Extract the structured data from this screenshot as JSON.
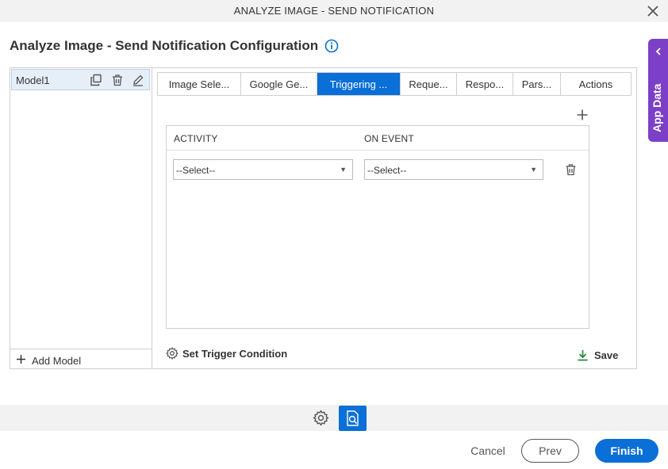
{
  "window": {
    "title": "ANALYZE IMAGE - SEND NOTIFICATION",
    "close_icon": "close-icon"
  },
  "page": {
    "heading": "Analyze Image - Send Notification Configuration",
    "info_icon": "info-icon"
  },
  "side_tab": {
    "label": "App Data",
    "icon": "chevron-left-icon",
    "color": "#7c3fc7"
  },
  "models": {
    "items": [
      {
        "name": "Model1"
      }
    ],
    "add_label": "Add Model",
    "item_icons": [
      "copy-icon",
      "trash-icon",
      "edit-icon"
    ]
  },
  "tabs": [
    {
      "label": "Image Sele...",
      "active": false
    },
    {
      "label": "Google Ge...",
      "active": false
    },
    {
      "label": "Triggering ...",
      "active": true
    },
    {
      "label": "Reque...",
      "active": false
    },
    {
      "label": "Respo...",
      "active": false
    },
    {
      "label": "Pars...",
      "active": false
    },
    {
      "label": "Actions",
      "active": false
    }
  ],
  "grid": {
    "columns": [
      "ACTIVITY",
      "ON EVENT"
    ],
    "rows": [
      {
        "activity": "--Select--",
        "on_event": "--Select--"
      }
    ]
  },
  "actions": {
    "set_trigger": "Set Trigger Condition",
    "save": "Save"
  },
  "footer": {
    "cancel": "Cancel",
    "prev": "Prev",
    "finish": "Finish"
  },
  "colors": {
    "accent": "#0a6fd6",
    "save_icon": "#1e8a3c"
  }
}
